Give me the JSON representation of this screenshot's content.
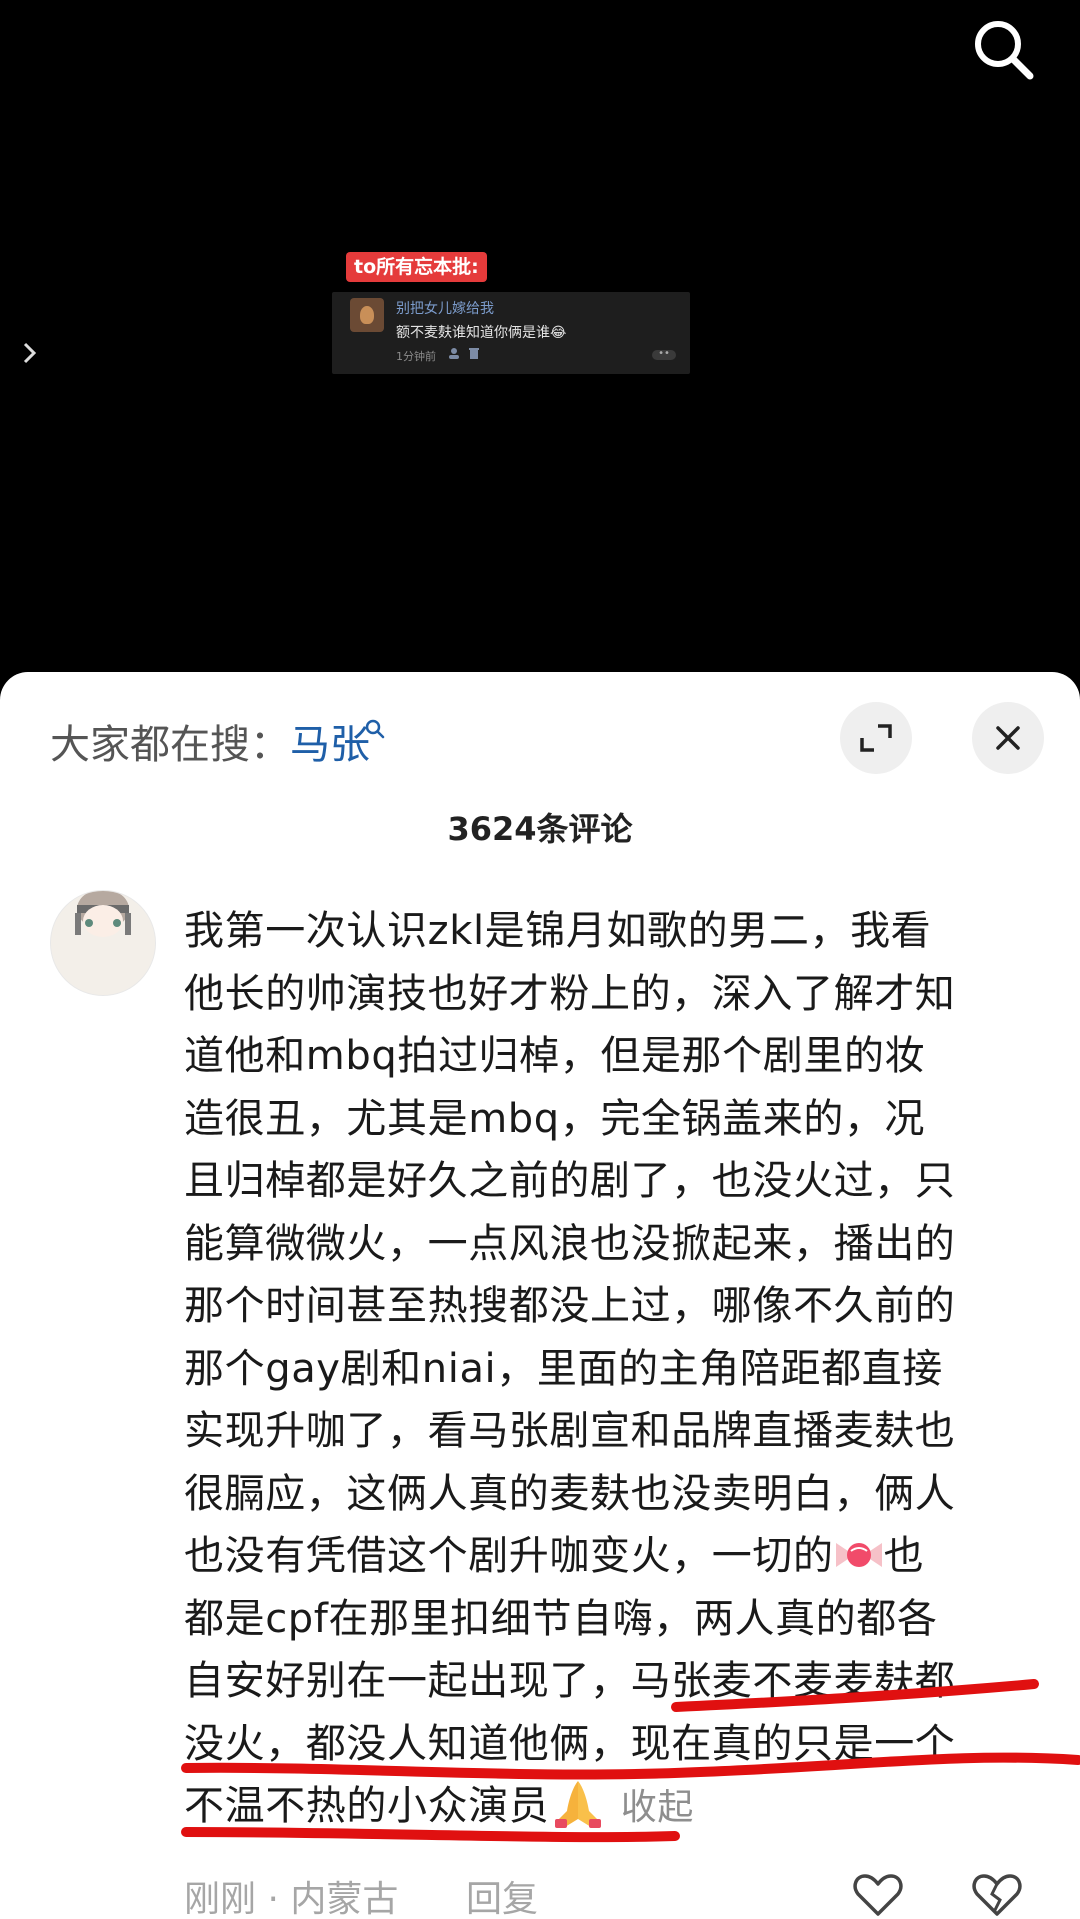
{
  "video": {
    "overlay_tag": "to所有忘本批:",
    "embedded_comment": {
      "username": "别把女儿嫁给我",
      "text": "额不麦麸谁知道你俩是谁😂",
      "time": "1分钟前",
      "more": "••"
    }
  },
  "sheet": {
    "hot_search_label": "大家都在搜：",
    "hot_search_term": "马张",
    "comment_count": "3624条评论"
  },
  "comment": {
    "lines": [
      "我第一次认识zkl是锦月如歌的男二，我看",
      "他长的帅演技也好才粉上的，深入了解才知",
      "道他和mbq拍过归棹，但是那个剧里的妆",
      "造很丑，尤其是mbq，完全锅盖来的，况",
      "且归棹都是好久之前的剧了，也没火过，只",
      "能算微微火，一点风浪也没掀起来，播出的",
      "那个时间甚至热搜都没上过，哪像不久前的",
      "那个gay剧和niai，里面的主角陪距都直接",
      "实现升咖了，看马张剧宣和品牌直播麦麸也",
      "很膈应，这俩人真的麦麸也没卖明白，俩人"
    ],
    "line_11_before_candy": "也没有凭借这个剧升咖变火，一切的",
    "line_11_after_candy": "也",
    "line_12": "都是cpf在那里扣细节自嗨，两人真的都各",
    "line_13": "自安好别在一起出现了，马张麦不麦麦麸都",
    "line_14": "没火，都没人知道他俩，现在真的只是一个",
    "line_15": "不温不热的小众演员",
    "collapse_label": "收起",
    "time_location": "刚刚 · 内蒙古",
    "reply_label": "回复"
  },
  "colors": {
    "accent_link": "#1f5fa8",
    "underline_red": "#e01010",
    "overlay_tag_bg": "#e53b3b"
  },
  "icons": [
    "search-icon",
    "chevron-right-icon",
    "expand-icon",
    "close-icon",
    "heart-icon",
    "broken-heart-icon",
    "candy-icon",
    "praying-hands-icon"
  ]
}
